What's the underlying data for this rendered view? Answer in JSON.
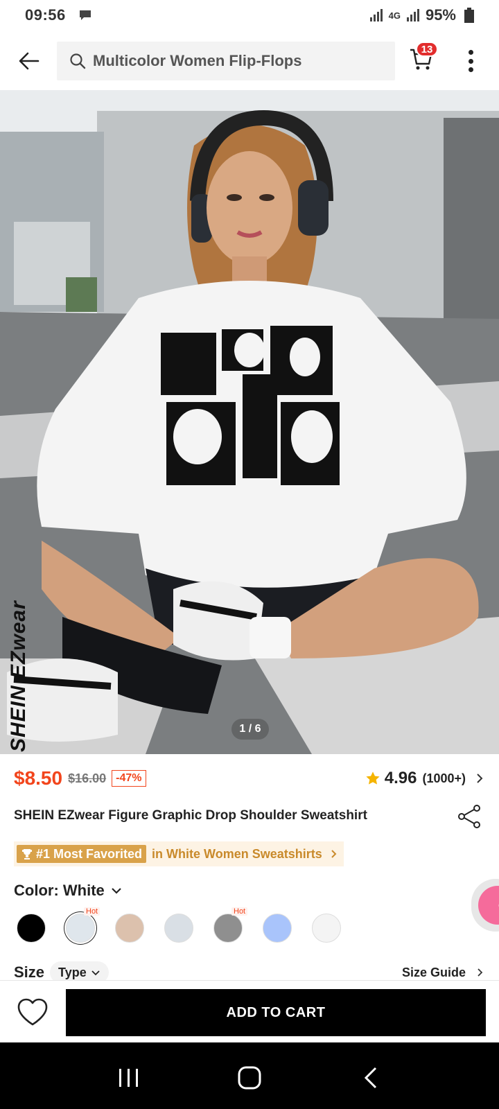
{
  "status_bar": {
    "time": "09:56",
    "network": "4G",
    "battery": "95%"
  },
  "header": {
    "search_text": "Multicolor Women Flip-Flops",
    "cart_count": "13"
  },
  "gallery": {
    "counter": "1 / 6",
    "watermark": "SHEIN EZwear"
  },
  "price": {
    "current": "$8.50",
    "original": "$16.00",
    "discount": "-47%"
  },
  "rating": {
    "score": "4.96",
    "count": "(1000+)"
  },
  "product": {
    "title": "SHEIN EZwear Figure Graphic Drop Shoulder Sweatshirt"
  },
  "rank": {
    "badge": "#1 Most Favorited",
    "text": "in White Women Sweatshirts"
  },
  "color": {
    "label": "Color: White",
    "swatches": [
      {
        "name": "Black",
        "hex": "#000000",
        "hot": false
      },
      {
        "name": "White",
        "hex": "#dfe6ec",
        "hot": true,
        "selected": true
      },
      {
        "name": "Apricot",
        "hex": "#dcc1ad",
        "hot": false
      },
      {
        "name": "Light Grey",
        "hex": "#d9dfe5",
        "hot": false
      },
      {
        "name": "Grey",
        "hex": "#8f8f8f",
        "hot": true
      },
      {
        "name": "Blue",
        "hex": "#a9c4fb",
        "hot": false
      },
      {
        "name": "Off White",
        "hex": "#f4f4f4",
        "hot": false
      }
    ],
    "hot_label": "Hot"
  },
  "size": {
    "label": "Size",
    "type_label": "Type",
    "guide_label": "Size Guide"
  },
  "actions": {
    "add_to_cart": "ADD TO CART"
  },
  "colors": {
    "accent": "#f2451c",
    "rank_gold": "#d9a24a",
    "cta_bg": "#000000"
  }
}
